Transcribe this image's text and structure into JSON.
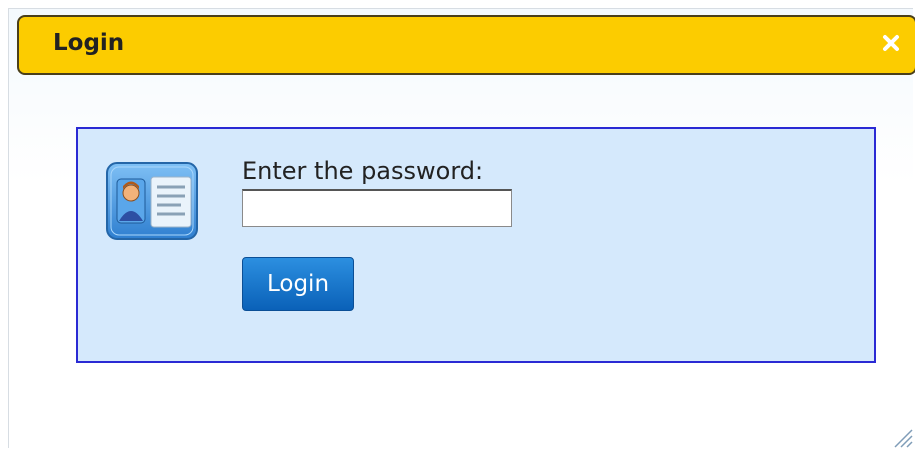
{
  "dialog": {
    "title": "Login",
    "close_icon": "close-icon",
    "resize_icon": "resize-grip-icon"
  },
  "form": {
    "icon": "user-card-icon",
    "prompt": "Enter the password:",
    "password_value": "",
    "password_placeholder": "",
    "submit_label": "Login"
  },
  "colors": {
    "titlebar": "#fccc00",
    "panel_bg": "#d5e9fc",
    "panel_border": "#2a2ad4",
    "button": "#0a61b8"
  }
}
